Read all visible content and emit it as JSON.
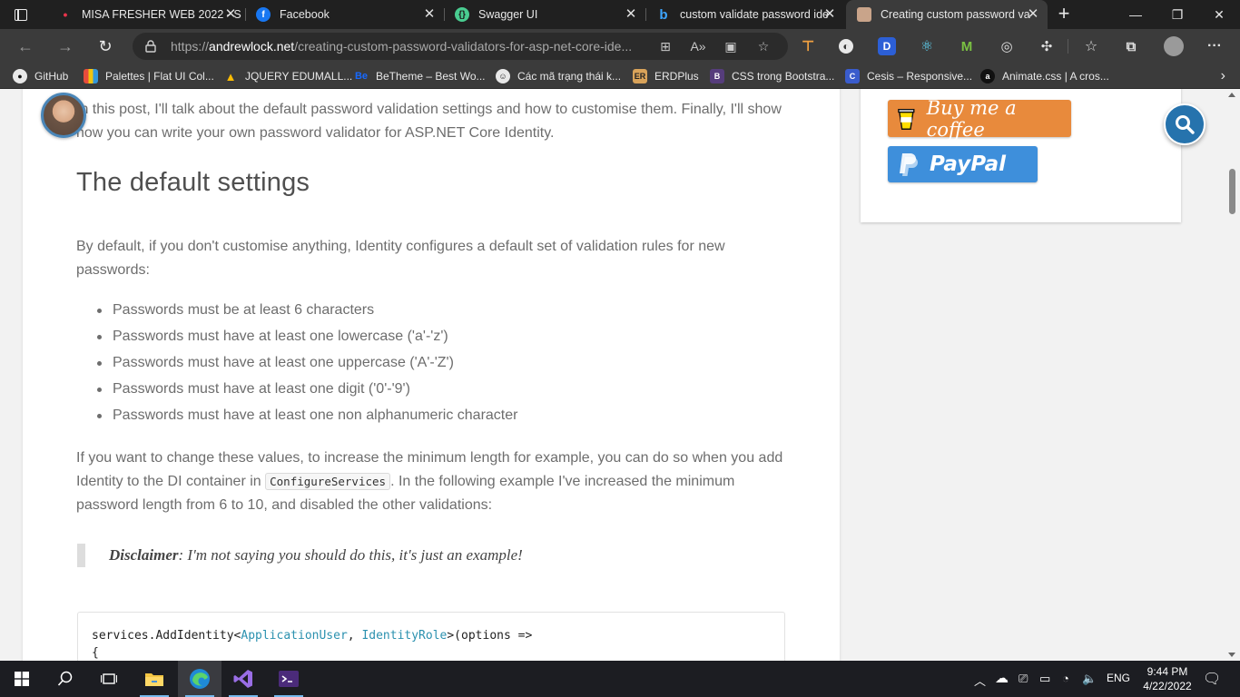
{
  "browser": {
    "tabs": [
      {
        "title": "MISA FRESHER WEB 2022 - S",
        "favicon": "misa-icon",
        "active": false
      },
      {
        "title": "Facebook",
        "favicon": "facebook-icon",
        "active": false
      },
      {
        "title": "Swagger UI",
        "favicon": "swagger-icon",
        "active": false
      },
      {
        "title": "custom validate password ide",
        "favicon": "bing-icon",
        "active": false
      },
      {
        "title": "Creating custom password va",
        "favicon": "author-avatar-icon",
        "active": true
      }
    ],
    "address": {
      "scheme": "https://",
      "host": "andrewlock.net",
      "path": "/creating-custom-password-validators-for-asp-net-core-ide..."
    },
    "bookmarks": [
      {
        "label": "GitHub",
        "icon": "github-icon"
      },
      {
        "label": "Palettes | Flat UI Col...",
        "icon": "palette-icon"
      },
      {
        "label": "JQUERY EDUMALL...",
        "icon": "google-drive-icon"
      },
      {
        "label": "BeTheme – Best Wo...",
        "icon": "behance-icon"
      },
      {
        "label": "Các mã trạng thái k...",
        "icon": "mozilla-icon"
      },
      {
        "label": "ERDPlus",
        "icon": "erdplus-icon"
      },
      {
        "label": "CSS trong Bootstra...",
        "icon": "bootstrap-icon"
      },
      {
        "label": "Cesis – Responsive...",
        "icon": "cesis-icon"
      },
      {
        "label": "Animate.css | A cros...",
        "icon": "animate-icon"
      }
    ]
  },
  "article": {
    "intro": "In this post, I'll talk about the default password validation settings and how to customise them. Finally, I'll show how you can write your own password validator for ASP.NET Core Identity.",
    "heading": "The default settings",
    "para1": "By default, if you don't customise anything, Identity configures a default set of validation rules for new passwords:",
    "rules": [
      "Passwords must be at least 6 characters",
      "Passwords must have at least one lowercase ('a'-'z')",
      "Passwords must have at least one uppercase ('A'-'Z')",
      "Passwords must have at least one digit ('0'-'9')",
      "Passwords must have at least one non alphanumeric character"
    ],
    "para2_before": "If you want to change these values, to increase the minimum length for example, you can do so when you add Identity to the DI container in ",
    "para2_code": "ConfigureServices",
    "para2_after": ". In the following example I've increased the minimum password length from 6 to 10, and disabled the other validations:",
    "disclaimer_label": "Disclaimer",
    "disclaimer_text": ": I'm not saying you should do this, it's just an example!",
    "code": {
      "line1_a": "services.AddIdentity<",
      "line1_type1": "ApplicationUser",
      "line1_b": ", ",
      "line1_type2": "IdentityRole",
      "line1_c": ">(options =>",
      "line2": "{"
    }
  },
  "sidebar": {
    "coffee_label": "Buy me a coffee",
    "paypal_label": "PayPal"
  },
  "taskbar": {
    "apps": [
      "windows-start-icon",
      "search-icon",
      "task-view-icon",
      "file-explorer-icon",
      "edge-icon",
      "visual-studio-icon",
      "terminal-icon"
    ],
    "lang": "ENG",
    "time": "9:44 PM",
    "date": "4/22/2022"
  },
  "colors": {
    "accent": "#2673ad",
    "coffee": "#e88a3c",
    "paypal": "#3e8fdb"
  }
}
